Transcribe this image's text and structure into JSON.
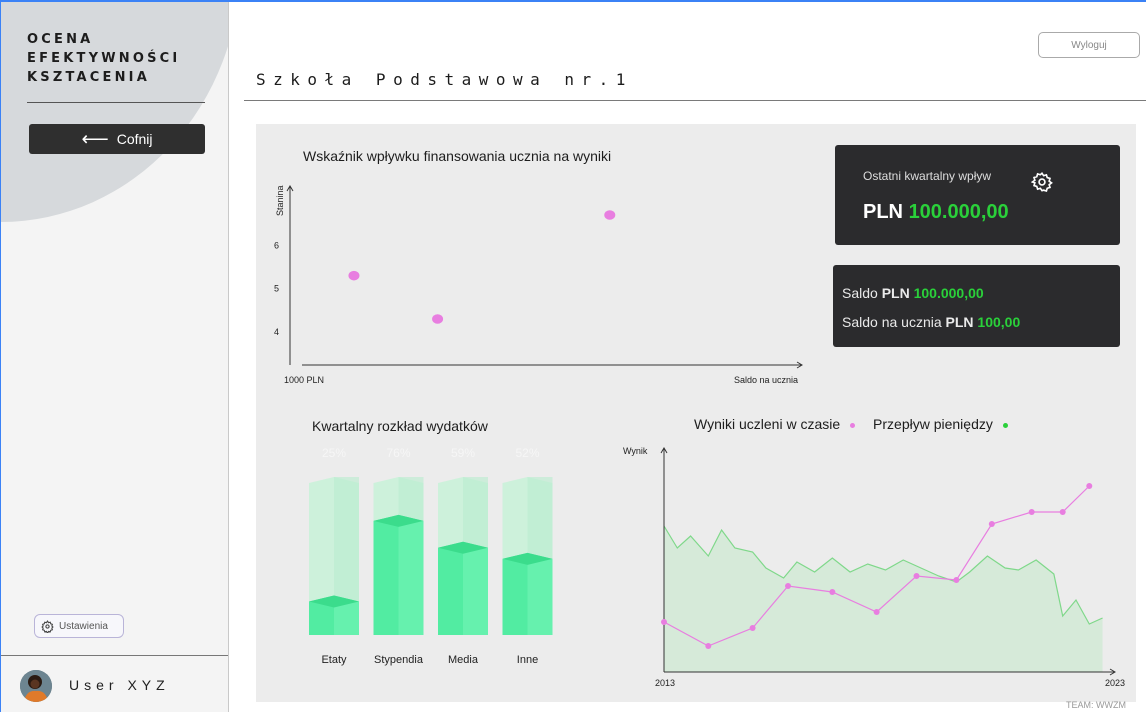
{
  "sidebar": {
    "brand_line1": "OCENA",
    "brand_line2": "EFEKTYWNOŚCI",
    "brand_line3": "KSZTACENIA",
    "back_label": "Cofnij",
    "settings_label": "Ustawienia",
    "user_name": "User XYZ"
  },
  "header": {
    "logout_label": "Wyloguj",
    "page_title": "Szkoła Podstawowa nr.1"
  },
  "cards": {
    "quarterly": {
      "label": "Ostatni kwartalny wpływ",
      "currency": "PLN",
      "amount": "100.000,00"
    },
    "balance": {
      "saldo_label": "Saldo",
      "saldo_currency": "PLN",
      "saldo_amount": "100.000,00",
      "per_student_label": "Saldo na ucznia",
      "per_student_currency": "PLN",
      "per_student_amount": "100,00"
    }
  },
  "colors": {
    "accent_green": "#2ad03a",
    "pink": "#e87ee0",
    "bar_green": "#3ee89a",
    "dark_card": "#2b2b2d"
  },
  "footer": {
    "team": "TEAM: WWZM"
  },
  "chart_data": [
    {
      "type": "scatter",
      "title": "Wskaźnik wpływku finansowania ucznia na wyniki",
      "xlabel": "Saldo na ucznia",
      "ylabel": "Stanina",
      "x_start_label": "1000 PLN",
      "y_ticks": [
        "4",
        "5",
        "6"
      ],
      "ylim": [
        3.7,
        7.0
      ],
      "xlim": [
        0,
        100
      ],
      "points": [
        {
          "x": 13,
          "y": 5.3
        },
        {
          "x": 30,
          "y": 4.3
        },
        {
          "x": 65,
          "y": 6.7
        }
      ]
    },
    {
      "type": "bar",
      "title": "Kwartalny rozkład wydatków",
      "categories": [
        "Etaty",
        "Stypendia",
        "Media",
        "Inne"
      ],
      "values": [
        25,
        76,
        59,
        52
      ],
      "percent_labels": [
        "25%",
        "76%",
        "59%",
        "52%"
      ]
    },
    {
      "type": "line",
      "title": "Wyniki uczleni w czasie",
      "ylabel": "Wynik",
      "x_start": "2013",
      "x_end": "2023",
      "ylim": [
        0,
        100
      ],
      "legend": [
        "Wyniki uczleni w czasie",
        "Przepływ pieniędzy"
      ],
      "series": [
        {
          "name": "Wyniki uczleni w czasie",
          "color": "#e87ee0",
          "markers": true,
          "x": [
            2013.0,
            2014.0,
            2015.0,
            2015.8,
            2016.8,
            2017.8,
            2018.7,
            2019.6,
            2020.4,
            2021.3,
            2022.0,
            2022.6
          ],
          "values": [
            25,
            13,
            22,
            43,
            40,
            30,
            48,
            46,
            74,
            80,
            80,
            93
          ]
        },
        {
          "name": "Przepływ pieniędzy",
          "color": "#7fd88a",
          "markers": false,
          "x": [
            2013.0,
            2013.3,
            2013.6,
            2014.0,
            2014.3,
            2014.6,
            2015.0,
            2015.3,
            2015.7,
            2016.0,
            2016.4,
            2016.8,
            2017.2,
            2017.6,
            2018.0,
            2018.4,
            2018.8,
            2019.2,
            2019.6,
            2019.9,
            2020.3,
            2020.7,
            2021.0,
            2021.4,
            2021.8,
            2022.0,
            2022.3,
            2022.6,
            2022.9
          ],
          "values": [
            73,
            62,
            68,
            58,
            71,
            62,
            60,
            52,
            47,
            55,
            50,
            57,
            50,
            54,
            51,
            56,
            52,
            48,
            45,
            50,
            58,
            52,
            51,
            56,
            49,
            28,
            36,
            24,
            27
          ]
        }
      ]
    }
  ]
}
